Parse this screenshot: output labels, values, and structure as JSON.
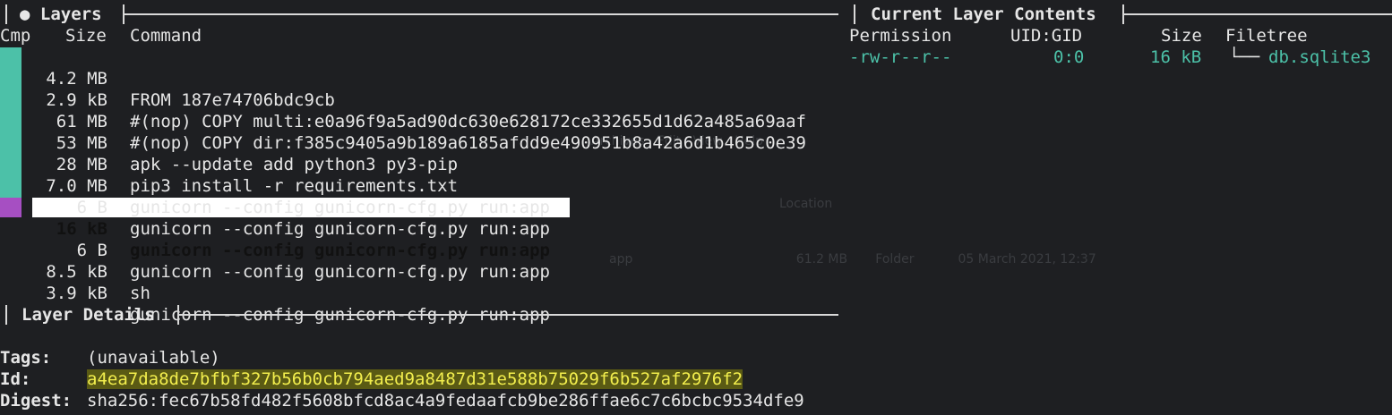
{
  "layers_panel": {
    "title": "● Layers",
    "headers": {
      "cmp": "Cmp",
      "size": "Size",
      "command": "Command"
    },
    "rows": [
      {
        "size": "4.2 MB",
        "command": "FROM 187e74706bdc9cb"
      },
      {
        "size": "2.9 kB",
        "command": "#(nop) COPY multi:e0a96f9a5ad90dc630e628172ce332655d1d62a485a69aaf"
      },
      {
        "size": "61 MB",
        "command": "#(nop) COPY dir:f385c9405a9b189a6185afdd9e490951b8a42a6d1b465c0e39"
      },
      {
        "size": "53 MB",
        "command": "apk --update add python3 py3-pip"
      },
      {
        "size": "28 MB",
        "command": "pip3 install -r requirements.txt"
      },
      {
        "size": "7.0 MB",
        "command": "gunicorn --config gunicorn-cfg.py run:app"
      },
      {
        "size": "6 B",
        "command": "gunicorn --config gunicorn-cfg.py run:app"
      },
      {
        "size": "16 kB",
        "command": "gunicorn --config gunicorn-cfg.py run:app"
      },
      {
        "size": "6 B",
        "command": "gunicorn --config gunicorn-cfg.py run:app"
      },
      {
        "size": "8.5 kB",
        "command": "sh"
      },
      {
        "size": "3.9 kB",
        "command": "gunicorn --config gunicorn-cfg.py run:app"
      }
    ],
    "selected_index": 7,
    "colors": {
      "cmp_bar": "#4cc1a8",
      "cmp_selected": "#a64fc2",
      "selection_bg": "#ffffff"
    }
  },
  "contents_panel": {
    "title": "Current Layer Contents",
    "headers": {
      "permission": "Permission",
      "uid_gid": "UID:GID",
      "size": "Size",
      "filetree": "Filetree"
    },
    "entry": {
      "permission": "-rw-r--r--",
      "uid_gid": "0:0",
      "size": "16 kB",
      "tree_prefix": "└──",
      "name": "db.sqlite3"
    },
    "colors": {
      "entry": "#4cc1a8"
    }
  },
  "details_panel": {
    "title": "Layer Details",
    "tags_label": "Tags:",
    "tags_value": "(unavailable)",
    "id_label": "Id:",
    "id_value": "a4ea7da8de7bfbf327b56b0cb794aed9a8487d31e588b75029f6b527af2976f2",
    "digest_label": "Digest:",
    "digest_value": "sha256:fec67b58fd482f5608bfcd8ac4a9fedaafcb9be286ffae6c7c6bcbc9534dfe9",
    "colors": {
      "id_highlight_bg": "#5a5a14",
      "id_text": "#f2ee4d"
    }
  }
}
